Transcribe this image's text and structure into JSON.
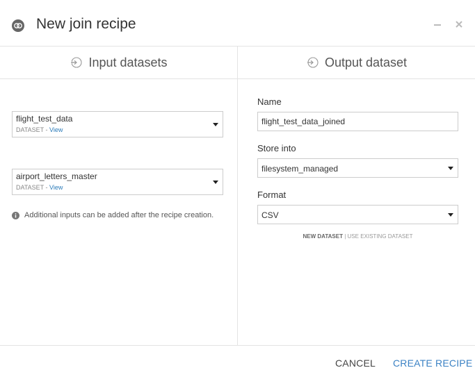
{
  "header": {
    "title": "New join recipe",
    "icons": {
      "recipe": "join-recipe-icon",
      "minimize": "minimize-icon",
      "close": "close-icon"
    }
  },
  "inputs": {
    "heading": "Input datasets",
    "datasets": [
      {
        "name": "flight_test_data",
        "type": "DATASET",
        "separator": " - ",
        "view_label": "View"
      },
      {
        "name": "airport_letters_master",
        "type": "DATASET",
        "separator": " - ",
        "view_label": "View"
      }
    ],
    "info": "Additional inputs can be added after the recipe creation."
  },
  "output": {
    "heading": "Output dataset",
    "name_label": "Name",
    "name_value": "flight_test_data_joined",
    "store_label": "Store into",
    "store_value": "filesystem_managed",
    "format_label": "Format",
    "format_value": "CSV",
    "new_dataset": "NEW DATASET",
    "separator": " | ",
    "use_existing": "USE EXISTING DATASET"
  },
  "footer": {
    "cancel": "CANCEL",
    "create": "CREATE RECIPE"
  },
  "colors": {
    "accent": "#3b82c4",
    "link": "#2b7bb9",
    "border": "#cccccc",
    "divider": "#e3e3e3"
  }
}
